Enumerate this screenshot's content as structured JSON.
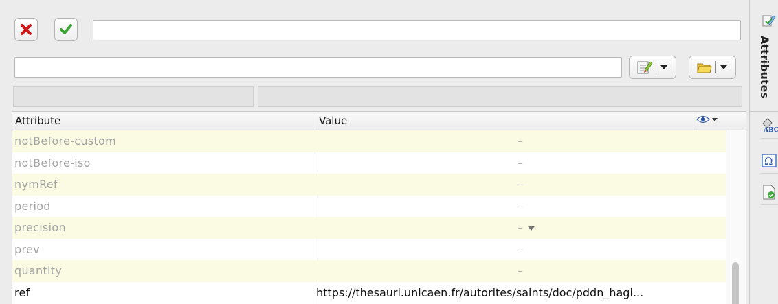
{
  "toolbar": {
    "cancel_icon": "red-x-icon",
    "confirm_icon": "green-check-icon",
    "value_field": "",
    "filter_field": "",
    "edit_dropdown_icon": "edit-document-icon",
    "folder_dropdown_icon": "folder-icon"
  },
  "table": {
    "columns": [
      "Attribute",
      "Value"
    ],
    "view_icon": "eye-icon",
    "rows": [
      {
        "name": "notBefore-custom",
        "value": "–"
      },
      {
        "name": "notBefore-iso",
        "value": "–"
      },
      {
        "name": "nymRef",
        "value": "–"
      },
      {
        "name": "period",
        "value": "–"
      },
      {
        "name": "precision",
        "value": "–"
      },
      {
        "name": "prev",
        "value": "–"
      },
      {
        "name": "quantity",
        "value": "–"
      },
      {
        "name": "ref",
        "value": "https://thesauri.unicaen.fr/autorites/saints/doc/pddn_hagi..."
      }
    ]
  },
  "sidebar": {
    "tab_label": "Attributes",
    "icons": [
      "attributes-edit-icon",
      "spellcheck-icon",
      "omega-icon",
      "validate-document-icon"
    ]
  },
  "colors": {
    "stripe": "#fbfbe3",
    "disabled_text": "#a3a3a3",
    "active_text": "#111111"
  }
}
